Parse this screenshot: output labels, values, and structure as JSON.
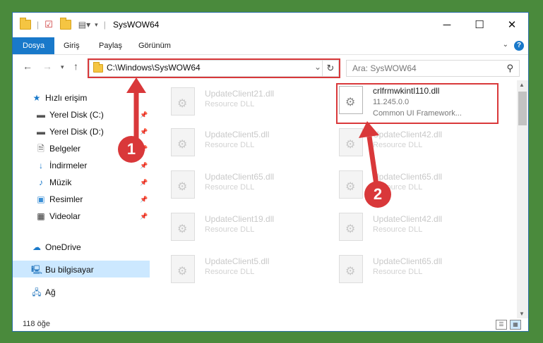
{
  "window": {
    "title": "SysWOW64",
    "controls": {
      "minimize": "─",
      "maximize": "☐",
      "close": "✕"
    }
  },
  "ribbon": {
    "tabs": [
      "Dosya",
      "Giriş",
      "Paylaş",
      "Görünüm"
    ],
    "help": "?"
  },
  "nav": {
    "address": "C:\\Windows\\SysWOW64",
    "search_placeholder": "Ara: SysWOW64"
  },
  "sidebar": {
    "items": [
      {
        "label": "Hızlı erişim",
        "icon": "star-icon",
        "pinned": false
      },
      {
        "label": "Yerel Disk (C:)",
        "icon": "drive-icon",
        "pinned": true
      },
      {
        "label": "Yerel Disk (D:)",
        "icon": "drive-icon",
        "pinned": true
      },
      {
        "label": "Belgeler",
        "icon": "document-icon",
        "pinned": true
      },
      {
        "label": "İndirmeler",
        "icon": "download-icon",
        "pinned": true
      },
      {
        "label": "Müzik",
        "icon": "music-icon",
        "pinned": true
      },
      {
        "label": "Resimler",
        "icon": "pictures-icon",
        "pinned": true
      },
      {
        "label": "Videolar",
        "icon": "video-icon",
        "pinned": true
      },
      {
        "label": "OneDrive",
        "icon": "cloud-icon",
        "pinned": false
      },
      {
        "label": "Bu bilgisayar",
        "icon": "computer-icon",
        "pinned": false,
        "selected": true
      },
      {
        "label": "Ağ",
        "icon": "network-icon",
        "pinned": false
      }
    ]
  },
  "files": {
    "left_column": [
      {
        "name": "UpdateClient21.dll",
        "desc": "Resource DLL"
      },
      {
        "name": "UpdateClient5.dll",
        "desc": "Resource DLL"
      },
      {
        "name": "UpdateClient65.dll",
        "desc": "Resource DLL"
      },
      {
        "name": "UpdateClient19.dll",
        "desc": "Resource DLL"
      },
      {
        "name": "UpdateClient5.dll",
        "desc": "Resource DLL"
      }
    ],
    "highlighted": {
      "name": "crlfrmwkintl110.dll",
      "version": "11.245.0.0",
      "desc": "Common UI Framework..."
    },
    "right_column": [
      {
        "name": "UpdateClient42.dll",
        "desc": "Resource DLL"
      },
      {
        "name": "UpdateClient65.dll",
        "desc": "Resource DLL"
      },
      {
        "name": "UpdateClient42.dll",
        "desc": "Resource DLL"
      },
      {
        "name": "UpdateClient65.dll",
        "desc": "Resource DLL"
      }
    ]
  },
  "status": {
    "count": "118 öğe"
  },
  "annotations": {
    "marker1": "1",
    "marker2": "2",
    "color": "#d9383a"
  },
  "colors": {
    "accent": "#1979ca",
    "selection": "#cce8ff"
  }
}
